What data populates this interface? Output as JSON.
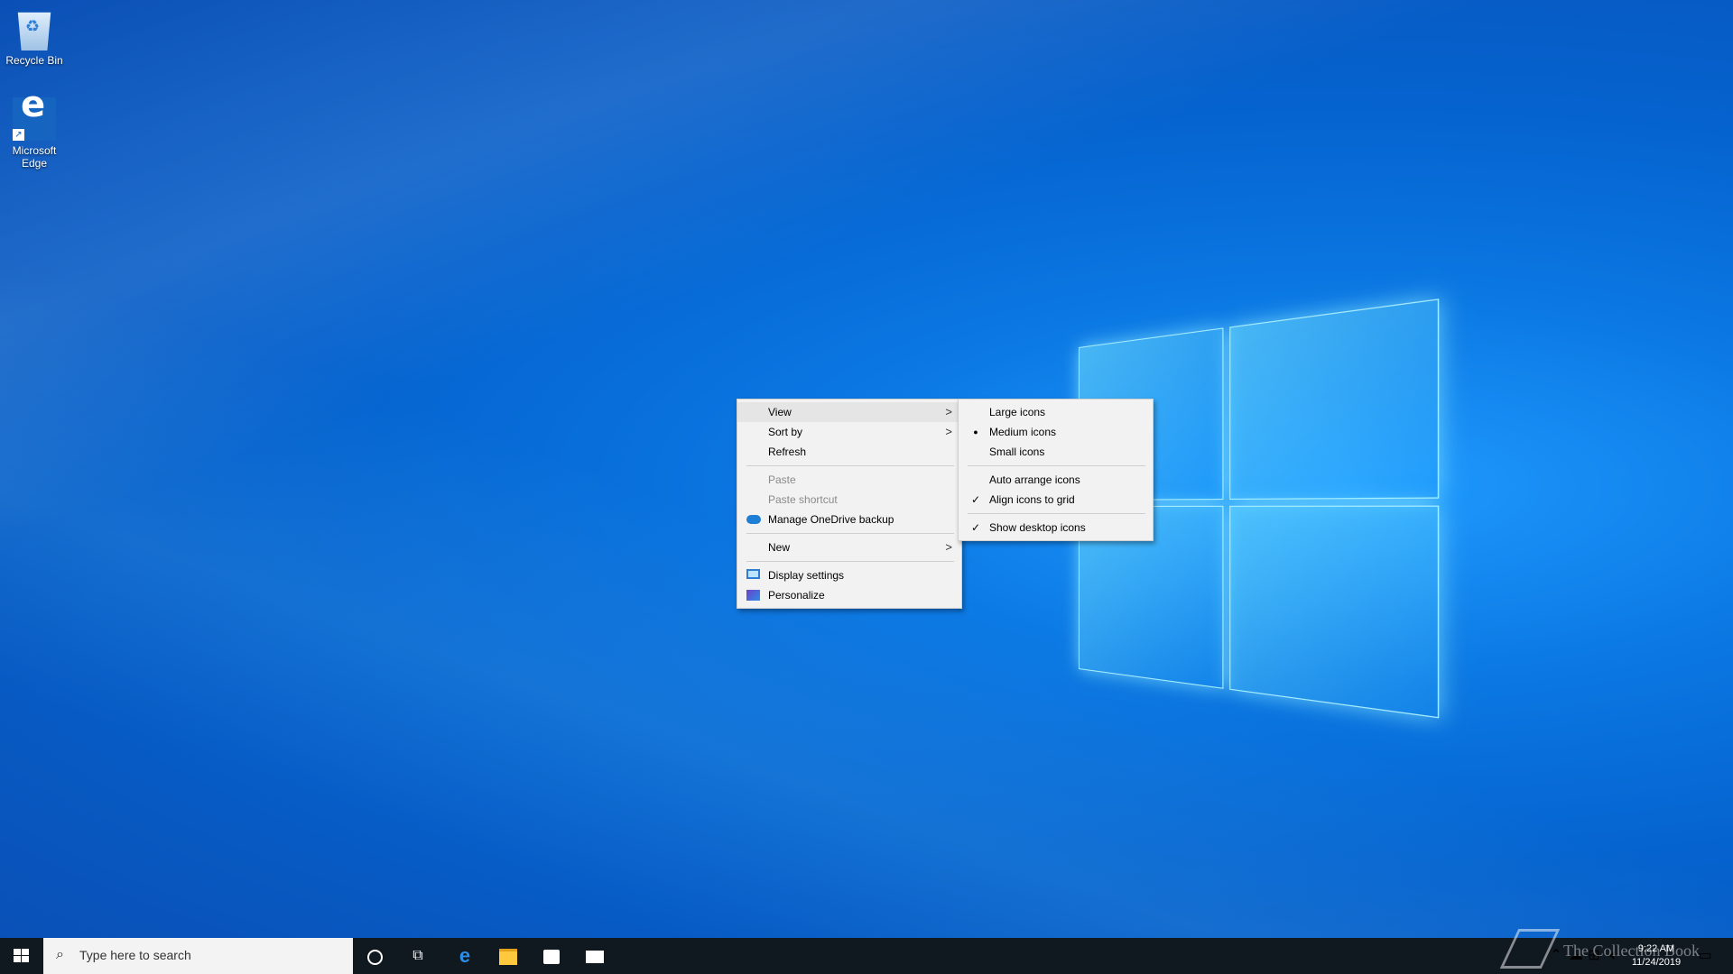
{
  "desktop": {
    "icons": [
      {
        "label": "Recycle Bin",
        "icon": "recycle-bin-icon"
      },
      {
        "label": "Microsoft Edge",
        "icon": "edge-icon"
      }
    ]
  },
  "context_menu": {
    "items": {
      "view": "View",
      "sort_by": "Sort by",
      "refresh": "Refresh",
      "paste": "Paste",
      "paste_shortcut": "Paste shortcut",
      "onedrive": "Manage OneDrive backup",
      "new": "New",
      "display_settings": "Display settings",
      "personalize": "Personalize"
    },
    "arrow": ">"
  },
  "view_submenu": {
    "items": {
      "large": "Large icons",
      "medium": "Medium icons",
      "small": "Small icons",
      "auto_arrange": "Auto arrange icons",
      "align_grid": "Align icons to grid",
      "show_desktop": "Show desktop icons"
    },
    "selected_size": "Medium icons",
    "checked": [
      "Align icons to grid",
      "Show desktop icons"
    ],
    "bullet": "●",
    "check": "✓"
  },
  "taskbar": {
    "search_placeholder": "Type here to search",
    "pinned": [
      "cortana-icon",
      "task-view-icon",
      "edge-icon",
      "file-explorer-icon",
      "store-icon",
      "mail-icon"
    ],
    "clock": {
      "time": "9:22 AM",
      "date": "11/24/2019"
    }
  },
  "watermark": "The Collection Book"
}
